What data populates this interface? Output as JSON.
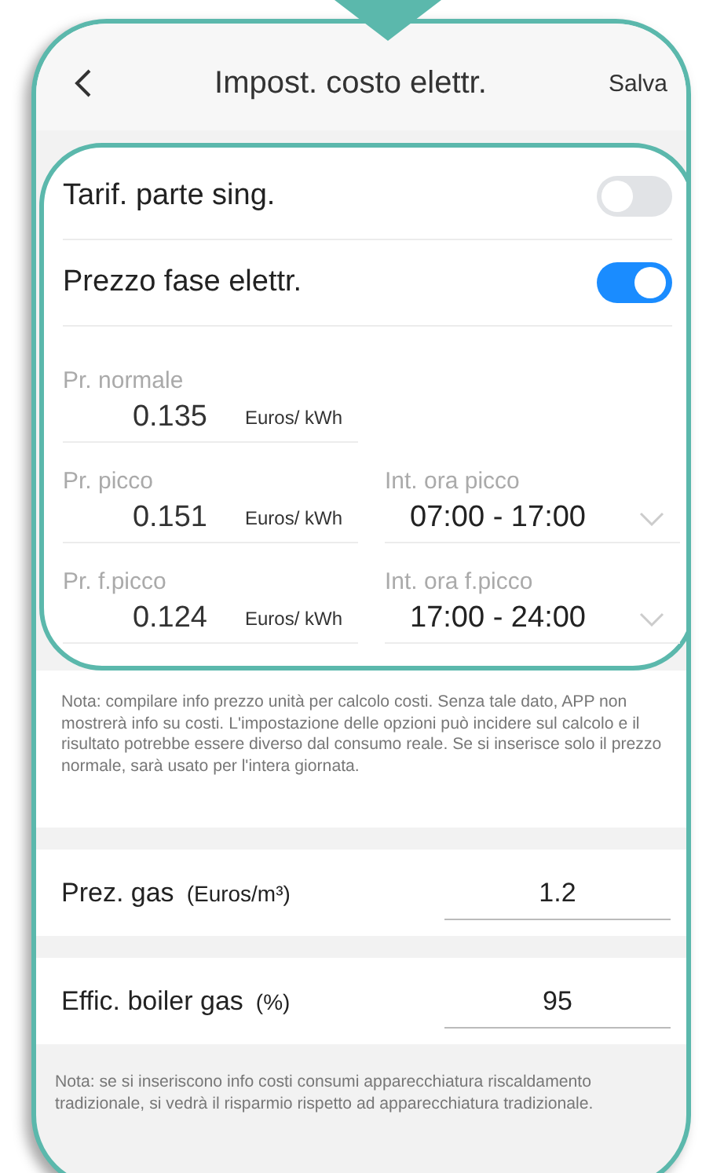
{
  "header": {
    "title": "Impost. costo elettr.",
    "action": "Salva"
  },
  "toggles": [
    {
      "label": "Tarif. parte sing.",
      "on": false
    },
    {
      "label": "Prezzo fase elettr.",
      "on": true
    }
  ],
  "prices": [
    {
      "label": "Pr. normale",
      "value": "0.135",
      "unit": "Euros/ kWh"
    },
    {
      "label": "Pr. picco",
      "value": "0.151",
      "unit": "Euros/ kWh",
      "interval": {
        "label": "Int. ora picco",
        "value": "07:00 - 17:00"
      }
    },
    {
      "label": "Pr. f.picco",
      "value": "0.124",
      "unit": "Euros/ kWh",
      "interval": {
        "label": "Int. ora f.picco",
        "value": "17:00 - 24:00"
      }
    }
  ],
  "price_note": "Nota: compilare info prezzo unità per calcolo costi. Senza tale dato, APP non mostrerà info su costi. L'impostazione delle opzioni può incidere sul calcolo e il risultato potrebbe essere diverso dal consumo reale. Se si inserisce solo il prezzo normale, sarà usato per l'intera giornata.",
  "gas": [
    {
      "label": "Prez. gas",
      "unit": "(Euros/m³)",
      "value": "1.2"
    },
    {
      "label": "Effic. boiler gas",
      "unit": "(%)",
      "value": "95"
    }
  ],
  "gas_note": "Nota: se si inseriscono info costi consumi apparecchiatura riscaldamento tradizionale, si vedrà il risparmio rispetto ad apparecchiatura tradizionale."
}
